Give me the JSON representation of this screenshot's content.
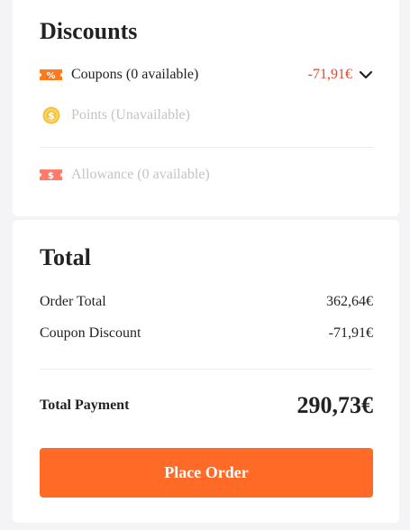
{
  "discounts": {
    "title": "Discounts",
    "coupons": {
      "label": "Coupons (0 available)",
      "value": "-71,91€",
      "icon": "percent-coupon-icon"
    },
    "points": {
      "label": "Points (Unavailable)",
      "icon": "coin-icon"
    },
    "allowance": {
      "label": "Allowance (0 available)",
      "icon": "dollar-ticket-icon"
    }
  },
  "total": {
    "title": "Total",
    "order_total": {
      "label": "Order Total",
      "value": "362,64€"
    },
    "coupon_discount": {
      "label": "Coupon Discount",
      "value": "-71,91€"
    },
    "total_payment": {
      "label": "Total Payment",
      "value": "290,73€"
    },
    "place_order_label": "Place Order"
  },
  "colors": {
    "accent": "#ff6a26",
    "discount_red": "#e8452c",
    "disabled_text": "#c3c3c3",
    "coin_yellow": "#f6c445",
    "allowance_pink": "#ff7b6b"
  }
}
